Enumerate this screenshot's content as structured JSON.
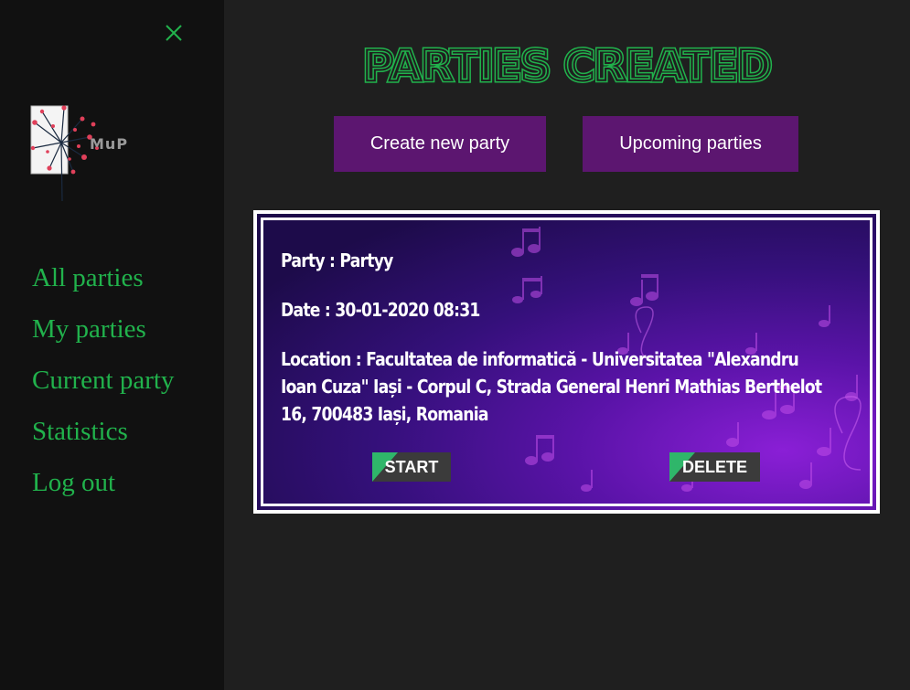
{
  "app": {
    "title": "Parties created",
    "logo_text": "MuP"
  },
  "sidebar": {
    "items": [
      {
        "label": "All parties"
      },
      {
        "label": "My parties"
      },
      {
        "label": "Current party"
      },
      {
        "label": "Statistics"
      },
      {
        "label": "Log out"
      }
    ]
  },
  "actions": {
    "create_label": "Create new party",
    "upcoming_label": "Upcoming parties"
  },
  "party_card": {
    "party_line": "Party : Partyy",
    "date_line": "Date : 30-01-2020 08:31",
    "location_line": "Location : Facultatea de informatică - Universitatea \"Alexandru Ioan Cuza\" Iași - Corpul C, Strada General Henri Mathias Berthelot 16, 700483 Iași, Romania",
    "start_label": "START",
    "delete_label": "DELETE"
  },
  "colors": {
    "accent_green": "#21b24c",
    "button_purple": "#5c1670",
    "sidebar_bg": "#111111",
    "page_bg": "#1f1f1f"
  },
  "icons": {
    "close": "close-icon",
    "notes": "music-note-icon"
  }
}
